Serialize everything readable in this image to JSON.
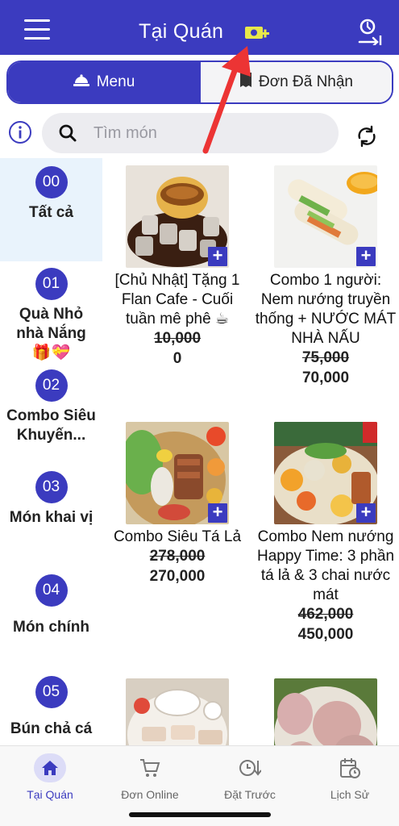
{
  "header": {
    "title": "Tại Quán",
    "menu_icon": "hamburger-icon",
    "badge_icon": "table-add-icon",
    "right_icon": "user-logout-icon",
    "accent": "#3b3bbf"
  },
  "tabs": [
    {
      "label": "Menu",
      "icon": "food-cloche-icon",
      "active": true
    },
    {
      "label": "Đơn Đã Nhận",
      "icon": "receipt-icon",
      "active": false
    }
  ],
  "search": {
    "placeholder": "Tìm món"
  },
  "categories": [
    {
      "num": "00",
      "label": "Tất cả",
      "active": true
    },
    {
      "num": "01",
      "label": "Quà Nhỏ nhà Nắng 🎁💝"
    },
    {
      "num": "02",
      "label": "Combo Siêu Khuyến..."
    },
    {
      "num": "03",
      "label": "Món khai vị"
    },
    {
      "num": "04",
      "label": "Món chính"
    },
    {
      "num": "05",
      "label": "Bún chả cá"
    }
  ],
  "products": [
    {
      "name": "[Chủ Nhật] Tặng 1 Flan Cafe - Cuối tuần mê phê ☕",
      "old_price": "10,000",
      "price": "0"
    },
    {
      "name": "Combo 1 người: Nem nướng truyền thống + NƯỚC MÁT NHÀ NẤU",
      "old_price": "75,000",
      "price": "70,000"
    },
    {
      "name": "Combo Siêu Tá Lả",
      "old_price": "278,000",
      "price": "270,000"
    },
    {
      "name": "Combo Nem nướng Happy Time: 3 phần tá lả & 3 chai nước mát",
      "old_price": "462,000",
      "price": "450,000"
    },
    {
      "name": "",
      "old_price": "",
      "price": ""
    },
    {
      "name": "",
      "old_price": "",
      "price": ""
    }
  ],
  "add_symbol": "+",
  "bottom_nav": [
    {
      "label": "Tại Quán",
      "icon": "home-icon",
      "active": true
    },
    {
      "label": "Đơn Online",
      "icon": "cart-icon"
    },
    {
      "label": "Đặt Trước",
      "icon": "clock-down-icon"
    },
    {
      "label": "Lịch Sử",
      "icon": "history-icon"
    }
  ]
}
